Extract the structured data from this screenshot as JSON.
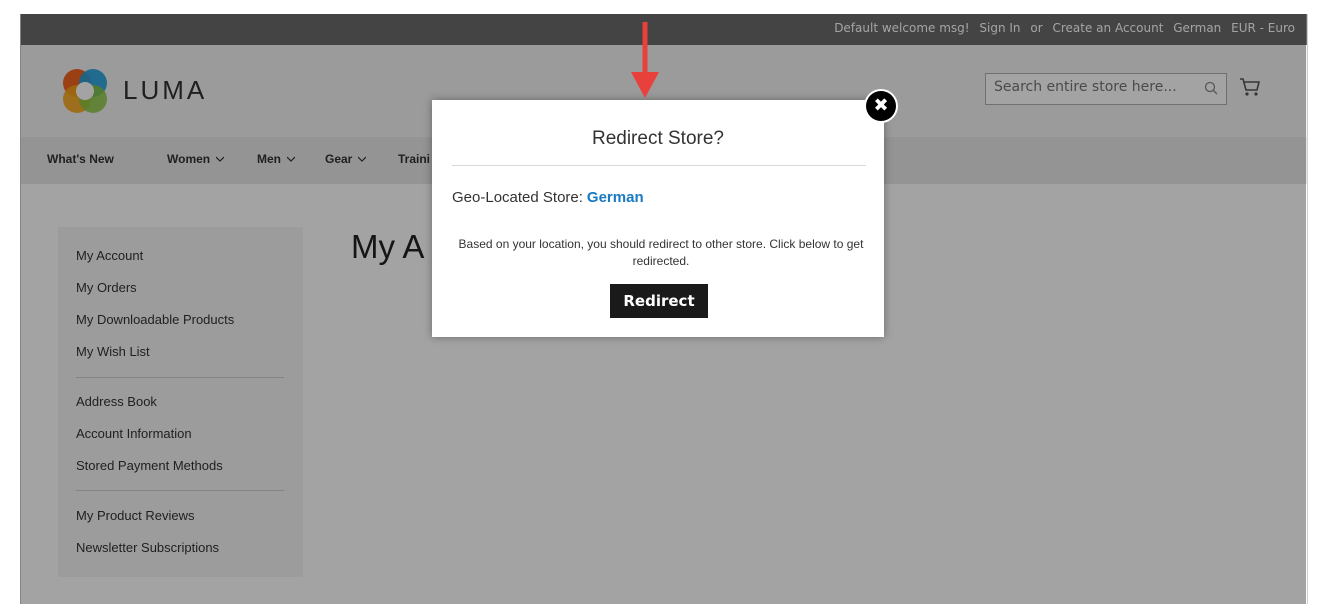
{
  "topbar": {
    "welcome": "Default welcome msg!",
    "sign_in": "Sign In",
    "or": "or",
    "create_account": "Create an Account",
    "language": "German",
    "currency": "EUR - Euro"
  },
  "header": {
    "logo_text": "LUMA",
    "search_placeholder": "Search entire store here..."
  },
  "nav": {
    "items": [
      "What's New",
      "Women",
      "Men",
      "Gear",
      "Traini"
    ]
  },
  "sidebar": {
    "group1": [
      "My Account",
      "My Orders",
      "My Downloadable Products",
      "My Wish List"
    ],
    "group2": [
      "Address Book",
      "Account Information",
      "Stored Payment Methods"
    ],
    "group3": [
      "My Product Reviews",
      "Newsletter Subscriptions"
    ]
  },
  "main": {
    "heading": "My A"
  },
  "modal": {
    "title": "Redirect Store?",
    "geo_label": "Geo-Located Store:",
    "geo_store": "German",
    "message": "Based on your location, you should redirect to other store. Click below to get redirected.",
    "redirect_label": "Redirect",
    "close_icon": "close-icon"
  },
  "colors": {
    "link_blue": "#1979c3",
    "overlay": "rgba(0,0,0,0.36)",
    "arrow_red": "#e8413c"
  }
}
